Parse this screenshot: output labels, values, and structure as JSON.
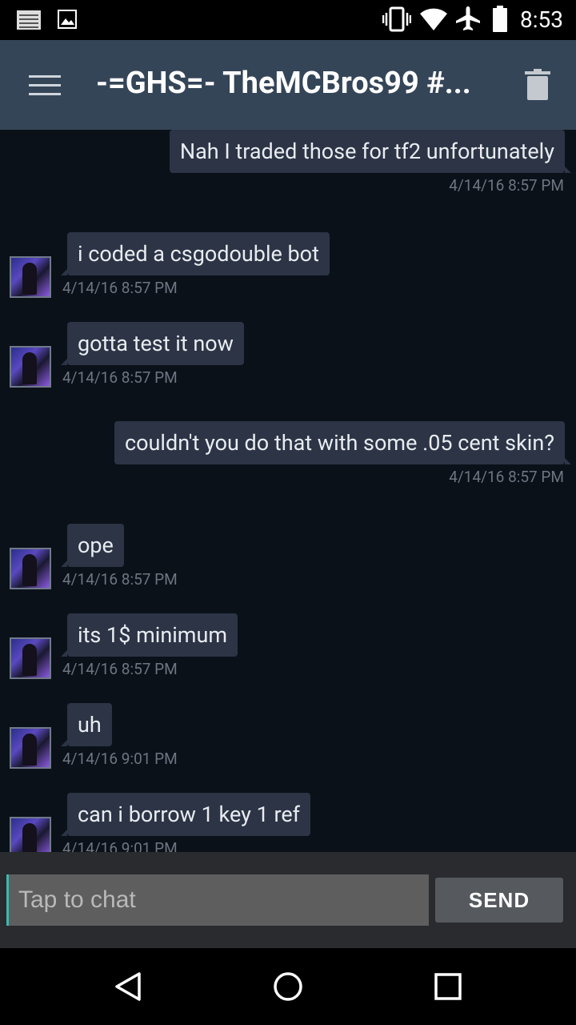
{
  "status_bar": {
    "time": "8:53",
    "left_icons": [
      "notification-icon",
      "image-icon"
    ],
    "right_icons": [
      "vibrate-icon",
      "wifi-icon",
      "airplane-icon",
      "battery-icon"
    ]
  },
  "app_bar": {
    "title": "-=GHS=- TheMCBros99 #...",
    "menu_icon": "menu-icon",
    "delete_icon": "trash-icon"
  },
  "messages": [
    {
      "direction": "out",
      "text": "Nah I traded those for tf2 unfortunately",
      "timestamp": "4/14/16 8:57 PM"
    },
    {
      "direction": "in",
      "text": "i coded a csgodouble bot",
      "timestamp": "4/14/16 8:57 PM"
    },
    {
      "direction": "in",
      "text": "gotta test it now",
      "timestamp": "4/14/16 8:57 PM"
    },
    {
      "direction": "out",
      "text": "couldn't you do that with some .05 cent skin?",
      "timestamp": "4/14/16 8:57 PM"
    },
    {
      "direction": "in",
      "text": "ope",
      "timestamp": "4/14/16 8:57 PM"
    },
    {
      "direction": "in",
      "text": "its 1$ minimum",
      "timestamp": "4/14/16 8:57 PM"
    },
    {
      "direction": "in",
      "text": "uh",
      "timestamp": "4/14/16 9:01 PM"
    },
    {
      "direction": "in",
      "text": "can i borrow 1 key 1 ref",
      "timestamp": "4/14/16 9:01 PM"
    }
  ],
  "composer": {
    "placeholder": "Tap to chat",
    "value": "",
    "send_label": "SEND"
  },
  "nav_bar": {
    "icons": [
      "back-icon",
      "home-icon",
      "recents-icon"
    ]
  }
}
